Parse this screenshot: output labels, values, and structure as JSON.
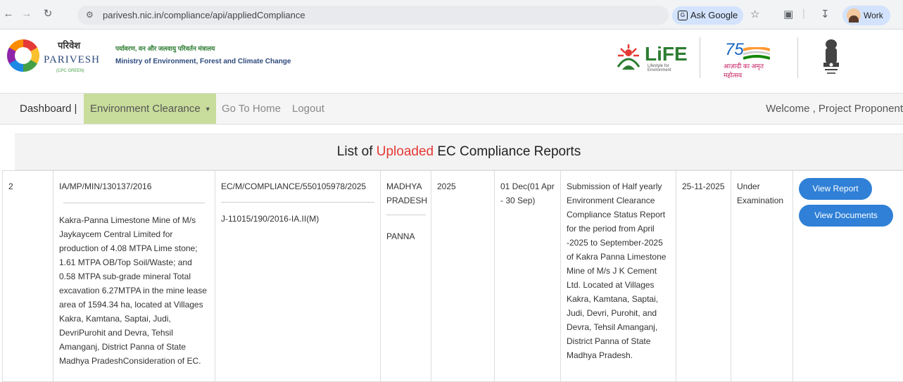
{
  "browser": {
    "url": "parivesh.nic.in/compliance/api/appliedCompliance",
    "ask_google": "Ask Google",
    "profile": "Work"
  },
  "header": {
    "brand_hindi": "परिवेश",
    "brand_main": "PARIVESH",
    "brand_sub": "(CPC GREEN)",
    "ministry_hindi": "पर्यावरण, वन और जलवायु परिवर्तन मंत्रालय",
    "ministry_en": "Ministry of Environment, Forest and Climate Change",
    "life_logo": "LiFE",
    "life_sub": "Lifestyle for Environment",
    "azadi_num": "75",
    "azadi_text": "आज़ादी का अमृत महोत्सव"
  },
  "nav": {
    "dashboard": "Dashboard |",
    "environment_clearance": "Environment Clearance",
    "go_home": "Go To Home",
    "logout": "Logout",
    "welcome": "Welcome , Project Proponent"
  },
  "page": {
    "title_prefix": "List of ",
    "title_highlight": "Uploaded",
    "title_suffix": " EC Compliance Reports"
  },
  "rows": [
    {
      "sr": "2",
      "proposal_no": "IA/MP/MIN/130137/2016",
      "proposal_desc": "Kakra-Panna Limestone Mine of M/s Jaykaycem Central Limited for production of 4.08 MTPA Lime stone; 1.61 MTPA OB/Top Soil/Waste; and 0.58 MTPA sub-grade mineral Total excavation 6.27MTPA in the mine lease area of 1594.34 ha, located at Villages Kakra, Kamtana, Saptai, Judi, DevriPurohit and Devra, Tehsil Amanganj, District Panna of State Madhya PradeshConsideration of EC.",
      "compliance_id": "EC/M/COMPLIANCE/550105978/2025",
      "file_no": "J-11015/190/2016-IA.II(M)",
      "state": "MADHYA PRADESH",
      "district": "PANNA",
      "year": "2025",
      "period": "01 Dec(01 Apr - 30 Sep)",
      "subject": "Submission of Half yearly Environment Clearance Compliance Status Report for the period from April -2025 to September-2025 of Kakra Panna Limestone Mine of M/s J K Cement Ltd. Located at Villages Kakra, Kamtana, Saptai, Judi, Devri, Purohit, and Devra, Tehsil Amanganj, District Panna of State Madhya Pradesh.",
      "submitted_on": "25-11-2025",
      "status": "Under Examination",
      "view_report": "View Report",
      "view_documents": "View Documents"
    }
  ]
}
